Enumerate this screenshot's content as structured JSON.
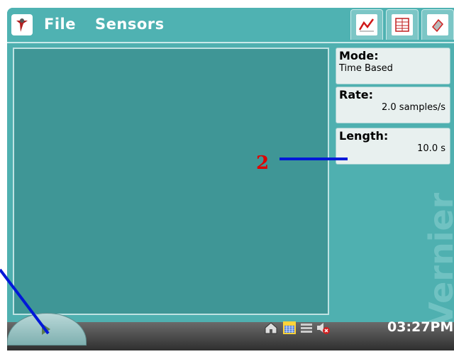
{
  "menu": {
    "file_label": "File",
    "sensors_label": "Sensors"
  },
  "tabs": [
    "graph-view",
    "table-view",
    "meter-view"
  ],
  "settings": {
    "mode_label": "Mode:",
    "mode_value": "Time Based",
    "rate_label": "Rate:",
    "rate_value": "2.0 samples/s",
    "length_label": "Length:",
    "length_value": "10.0 s"
  },
  "watermark": "Vernier",
  "taskbar": {
    "clock": "03:27PM"
  },
  "annotation": {
    "marker": "2"
  },
  "colors": {
    "screen": "#4fb0b0",
    "graph": "#3f9696",
    "annotation_text": "#e00000",
    "annotation_line": "#0018d8"
  }
}
